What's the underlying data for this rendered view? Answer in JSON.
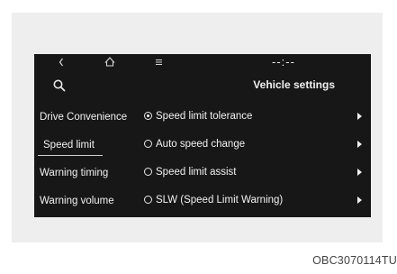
{
  "topbar": {
    "back_icon": "chevron-left-icon",
    "home_icon": "home-icon",
    "menu_icon": "menu-icon",
    "clock": "--:--"
  },
  "header": {
    "search_icon": "search-icon",
    "title": "Vehicle settings"
  },
  "sidebar": {
    "items": [
      {
        "label": "Drive Convenience",
        "active": false
      },
      {
        "label": "Speed limit",
        "active": true
      },
      {
        "label": "Warning timing",
        "active": false
      },
      {
        "label": "Warning volume",
        "active": false
      }
    ]
  },
  "options": {
    "items": [
      {
        "label": "Speed limit tolerance",
        "selected": true
      },
      {
        "label": "Auto speed change",
        "selected": false
      },
      {
        "label": "Speed limit assist",
        "selected": false
      },
      {
        "label": "SLW (Speed Limit Warning)",
        "selected": false
      }
    ]
  },
  "caption": "OBC3070114TU"
}
